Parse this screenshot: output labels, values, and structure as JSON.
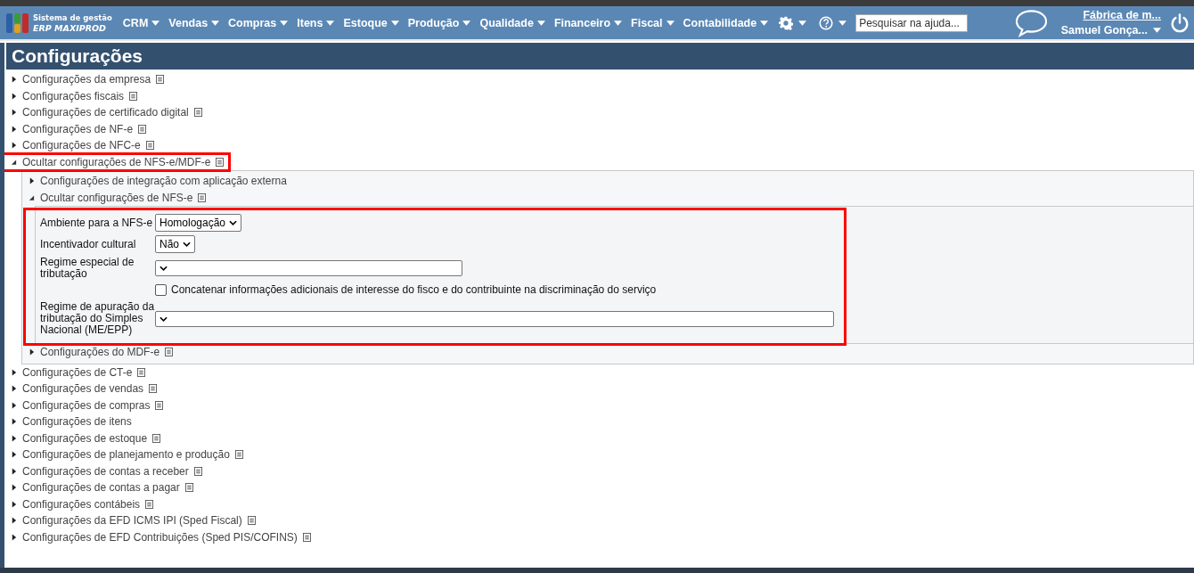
{
  "header": {
    "logo_line1": "Sistema de gestão",
    "logo_line2": "ERP MAXIPROD",
    "menu": [
      {
        "label": "CRM"
      },
      {
        "label": "Vendas"
      },
      {
        "label": "Compras"
      },
      {
        "label": "Itens"
      },
      {
        "label": "Estoque"
      },
      {
        "label": "Produção"
      },
      {
        "label": "Qualidade"
      },
      {
        "label": "Financeiro"
      },
      {
        "label": "Fiscal"
      },
      {
        "label": "Contabilidade"
      }
    ],
    "search": {
      "placeholder": "Pesquisar na ajuda..."
    },
    "company": "Fábrica de m...",
    "user": "Samuel Gonça..."
  },
  "page_title": "Configurações",
  "sections": [
    {
      "label": "Configurações da empresa",
      "expanded": false,
      "note": true,
      "highlighted": false
    },
    {
      "label": "Configurações fiscais",
      "expanded": false,
      "note": true,
      "highlighted": false
    },
    {
      "label": "Configurações de certificado digital",
      "expanded": false,
      "note": true,
      "highlighted": false
    },
    {
      "label": "Configurações de NF-e",
      "expanded": false,
      "note": true,
      "highlighted": false
    },
    {
      "label": "Configurações de NFC-e",
      "expanded": false,
      "note": true,
      "highlighted": false
    },
    {
      "label": "Ocultar configurações de NFS-e/MDF-e",
      "expanded": true,
      "note": true,
      "highlighted": true,
      "children": [
        {
          "label": "Configurações de integração com aplicação externa",
          "expanded": false,
          "note": false,
          "highlighted": false
        },
        {
          "label": "Ocultar configurações de NFS-e",
          "expanded": true,
          "note": true,
          "highlighted": true,
          "form": [
            {
              "kind": "select",
              "label": "Ambiente para a NFS-e",
              "value": "Homologação"
            },
            {
              "kind": "select",
              "label": "Incentivador cultural",
              "value": "Não"
            },
            {
              "kind": "select",
              "label": "Regime especial de tributação"
            },
            {
              "kind": "checkbox",
              "label": "Concatenar informações adicionais de interesse do fisco e do contribuinte na discriminação do serviço",
              "checked": false
            },
            {
              "kind": "select",
              "label": "Regime de apuração da tributação do Simples Nacional (ME/EPP)"
            }
          ]
        },
        {
          "label": "Configurações do MDF-e",
          "expanded": false,
          "note": true,
          "highlighted": false
        }
      ]
    },
    {
      "label": "Configurações de CT-e",
      "expanded": false,
      "note": true,
      "highlighted": false
    },
    {
      "label": "Configurações de vendas",
      "expanded": false,
      "note": true,
      "highlighted": false
    },
    {
      "label": "Configurações de compras",
      "expanded": false,
      "note": true,
      "highlighted": false
    },
    {
      "label": "Configurações de itens",
      "expanded": false,
      "note": false,
      "highlighted": false
    },
    {
      "label": "Configurações de estoque",
      "expanded": false,
      "note": true,
      "highlighted": false
    },
    {
      "label": "Configurações de planejamento e produção",
      "expanded": false,
      "note": true,
      "highlighted": false
    },
    {
      "label": "Configurações de contas a receber",
      "expanded": false,
      "note": true,
      "highlighted": false
    },
    {
      "label": "Configurações de contas a pagar",
      "expanded": false,
      "note": true,
      "highlighted": false
    },
    {
      "label": "Configurações contábeis",
      "expanded": false,
      "note": true,
      "highlighted": false
    },
    {
      "label": "Configurações da EFD ICMS IPI (Sped Fiscal)",
      "expanded": false,
      "note": true,
      "highlighted": false
    },
    {
      "label": "Configurações de EFD Contribuições (Sped PIS/COFINS)",
      "expanded": false,
      "note": true,
      "highlighted": false
    }
  ]
}
